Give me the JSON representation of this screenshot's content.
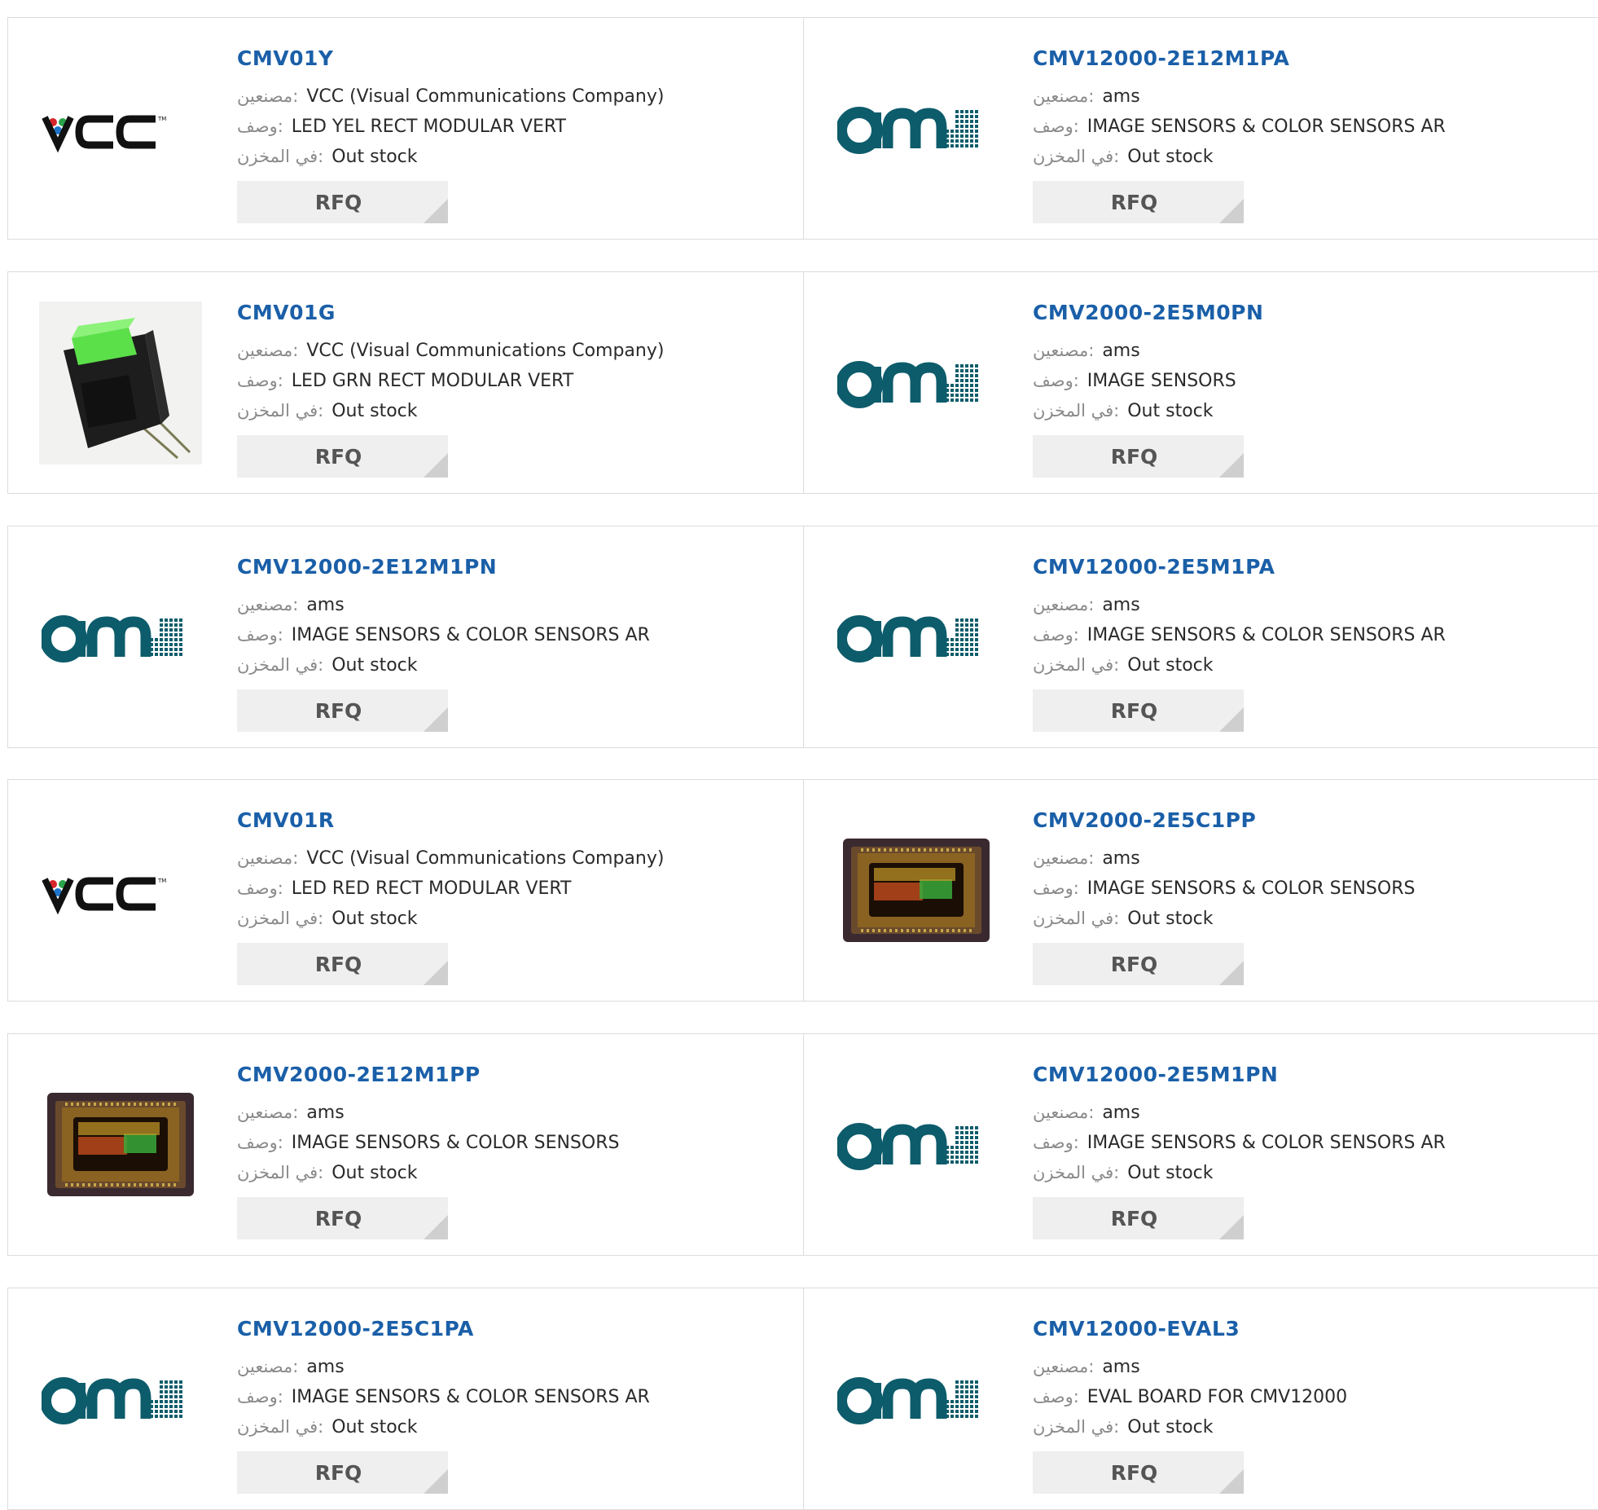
{
  "labels": {
    "manufacturer": ":مصنعين",
    "description": ":وصف",
    "stock": ":في المخزن",
    "rfq": "RFQ"
  },
  "logos": {
    "vcc": "VCC",
    "ams": "ams"
  },
  "products": [
    {
      "pn": "CMV01Y",
      "logo": "vcc",
      "manufacturer": "VCC (Visual Communications Company)",
      "description": "LED YEL RECT MODULAR VERT",
      "stock": "Out stock"
    },
    {
      "pn": "CMV12000-2E12M1PA",
      "logo": "ams",
      "manufacturer": "ams",
      "description": "IMAGE SENSORS & COLOR SENSORS AR",
      "stock": "Out stock"
    },
    {
      "pn": "CMV01G",
      "logo": "led-green",
      "manufacturer": "VCC (Visual Communications Company)",
      "description": "LED GRN RECT MODULAR VERT",
      "stock": "Out stock"
    },
    {
      "pn": "CMV2000-2E5M0PN",
      "logo": "ams",
      "manufacturer": "ams",
      "description": "IMAGE SENSORS",
      "stock": "Out stock"
    },
    {
      "pn": "CMV12000-2E12M1PN",
      "logo": "ams",
      "manufacturer": "ams",
      "description": "IMAGE SENSORS & COLOR SENSORS AR",
      "stock": "Out stock"
    },
    {
      "pn": "CMV12000-2E5M1PA",
      "logo": "ams",
      "manufacturer": "ams",
      "description": "IMAGE SENSORS & COLOR SENSORS AR",
      "stock": "Out stock"
    },
    {
      "pn": "CMV01R",
      "logo": "vcc",
      "manufacturer": "VCC (Visual Communications Company)",
      "description": "LED RED RECT MODULAR VERT",
      "stock": "Out stock"
    },
    {
      "pn": "CMV2000-2E5C1PP",
      "logo": "sensor-chip",
      "manufacturer": "ams",
      "description": "IMAGE SENSORS & COLOR SENSORS",
      "stock": "Out stock"
    },
    {
      "pn": "CMV2000-2E12M1PP",
      "logo": "sensor-chip",
      "manufacturer": "ams",
      "description": "IMAGE SENSORS & COLOR SENSORS",
      "stock": "Out stock"
    },
    {
      "pn": "CMV12000-2E5M1PN",
      "logo": "ams",
      "manufacturer": "ams",
      "description": "IMAGE SENSORS & COLOR SENSORS AR",
      "stock": "Out stock"
    },
    {
      "pn": "CMV12000-2E5C1PA",
      "logo": "ams",
      "manufacturer": "ams",
      "description": "IMAGE SENSORS & COLOR SENSORS AR",
      "stock": "Out stock"
    },
    {
      "pn": "CMV12000-EVAL3",
      "logo": "ams",
      "manufacturer": "ams",
      "description": "EVAL BOARD FOR CMV12000",
      "stock": "Out stock"
    }
  ]
}
